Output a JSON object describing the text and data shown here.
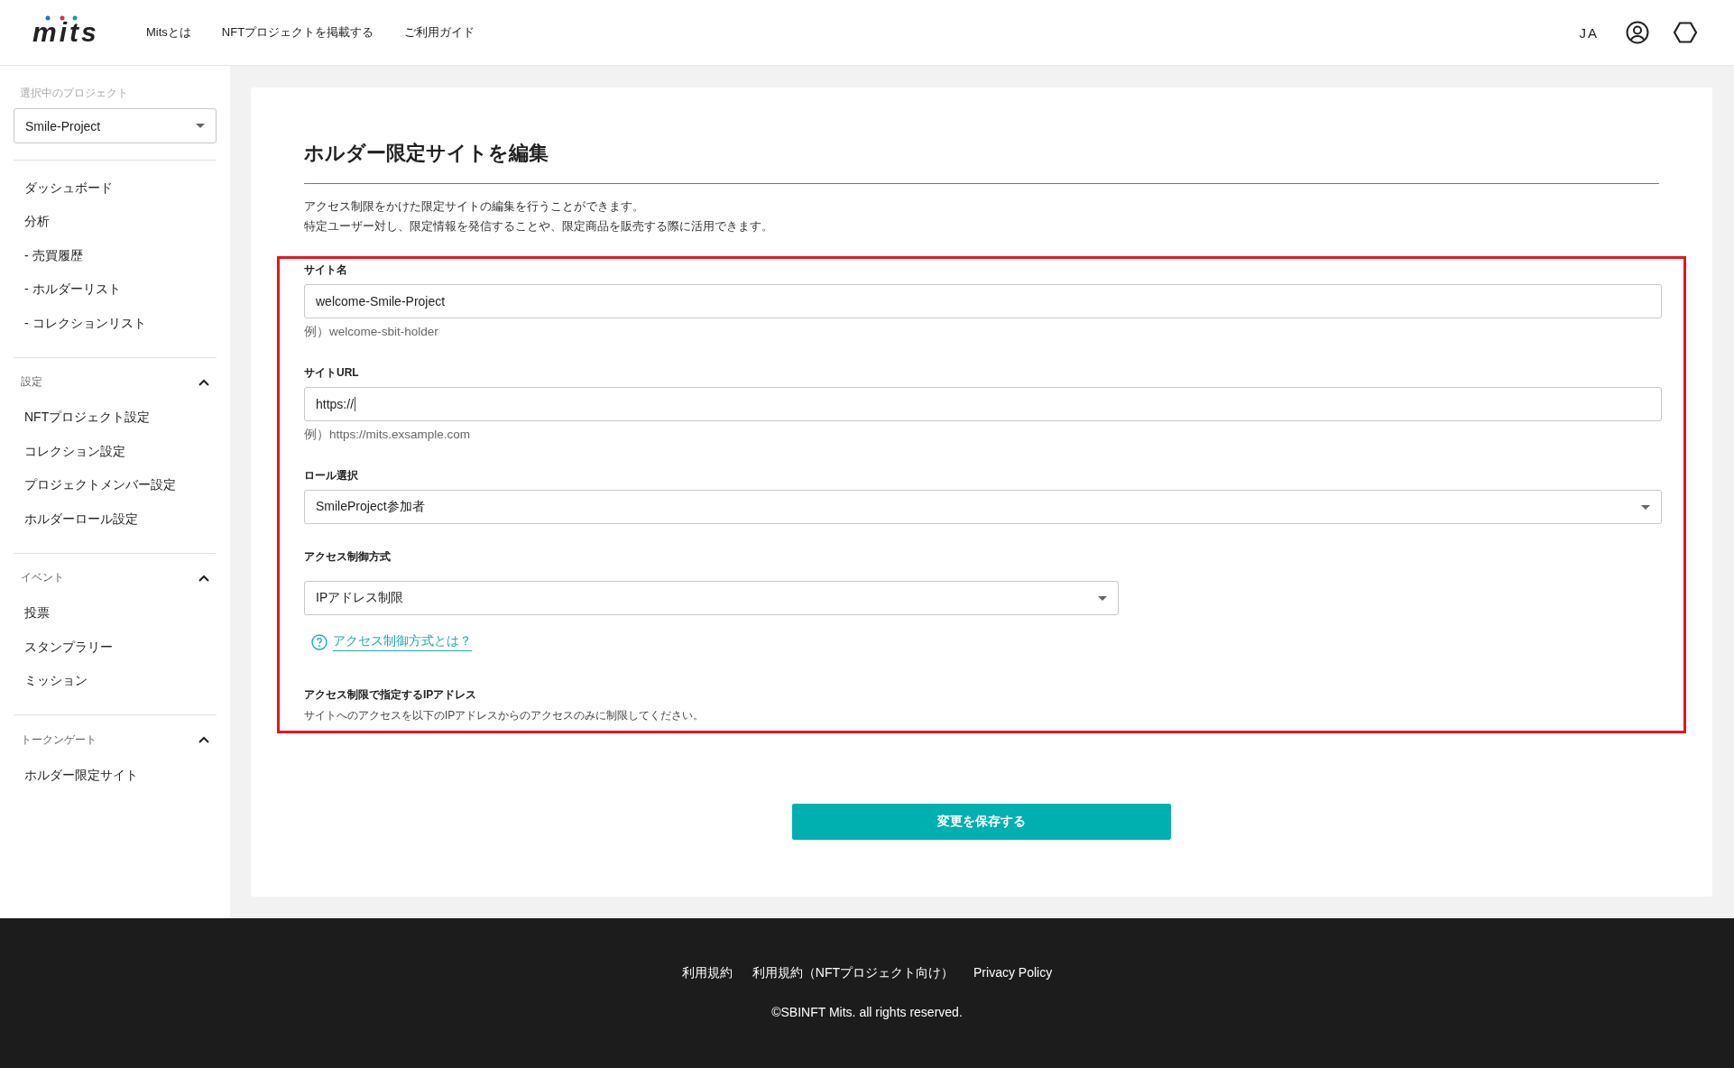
{
  "header": {
    "logo": "mits",
    "nav": [
      "Mitsとは",
      "NFTプロジェクトを掲載する",
      "ご利用ガイド"
    ],
    "language": "JA"
  },
  "sidebar": {
    "project_label": "選択中のプロジェクト",
    "project": "Smile-Project",
    "items": [
      "ダッシュボード",
      "分析",
      "- 売買履歴",
      "- ホルダーリスト",
      "- コレクションリスト"
    ],
    "groups": [
      {
        "title": "設定",
        "expanded": true,
        "items": [
          "NFTプロジェクト設定",
          "コレクション設定",
          "プロジェクトメンバー設定",
          "ホルダーロール設定"
        ]
      },
      {
        "title": "イベント",
        "expanded": true,
        "items": [
          "投票",
          "スタンプラリー",
          "ミッション"
        ]
      },
      {
        "title": "トークンゲート",
        "expanded": true,
        "items": [
          "ホルダー限定サイト"
        ]
      }
    ]
  },
  "page": {
    "title": "ホルダー限定サイトを編集",
    "description": [
      "アクセス制限をかけた限定サイトの編集を行うことができます。",
      "特定ユーザー対し、限定情報を発信することや、限定商品を販売する際に活用できます。"
    ],
    "fields": [
      {
        "kind": "text",
        "label": "サイト名",
        "value": "welcome-Smile-Project",
        "hint": "例）welcome-sbit-holder"
      },
      {
        "kind": "text",
        "label": "サイトURL",
        "value": "https://",
        "hint": "例）https://mits.exsample.com"
      },
      {
        "kind": "select",
        "label": "ロール選択",
        "value": "SmileProject参加者"
      },
      {
        "kind": "select_half",
        "label": "アクセス制御方式",
        "value": "IPアドレス制限"
      }
    ],
    "help_link": "アクセス制御方式とは？",
    "ip_section": {
      "title": "アクセス制限で指定するIPアドレス",
      "note": "サイトへのアクセスを以下のIPアドレスからのアクセスのみに制限してください。"
    },
    "save_button": "変更を保存する"
  },
  "footer": {
    "links": [
      "利用規約",
      "利用規約（NFTプロジェクト向け）",
      "Privacy Policy"
    ],
    "copyright": "©SBINFT Mits. all rights reserved."
  }
}
